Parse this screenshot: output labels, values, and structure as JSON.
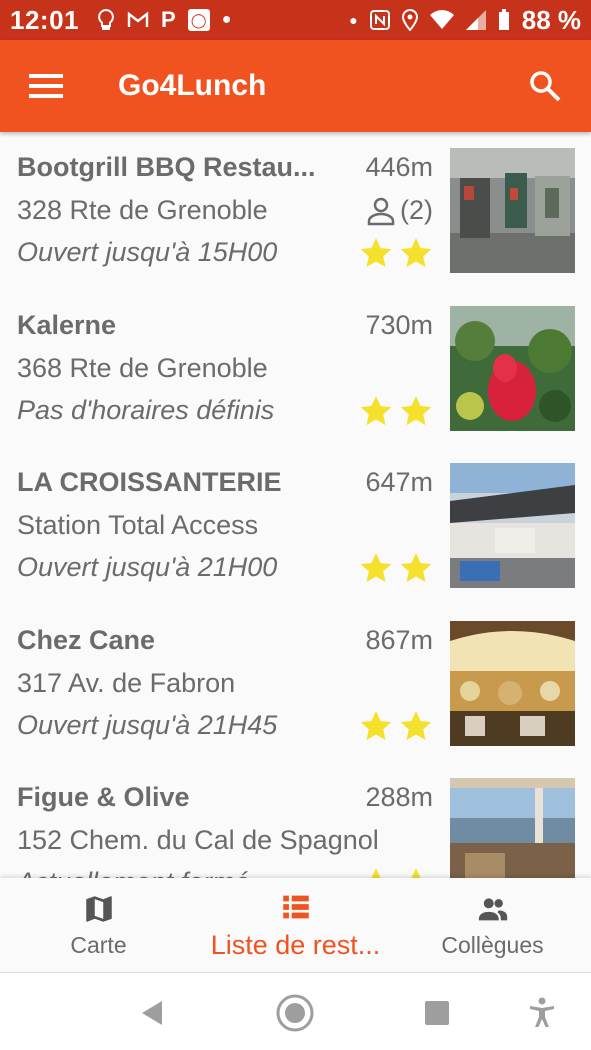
{
  "status_bar": {
    "time": "12:01",
    "battery": "88 %",
    "p_icon": "P"
  },
  "app_bar": {
    "title": "Go4Lunch",
    "menu_icon": "hamburger-menu-icon",
    "search_icon": "search-icon"
  },
  "restaurants": [
    {
      "name": "Bootgrill BBQ Restau...",
      "address": "328 Rte de Grenoble",
      "hours": "Ouvert jusqu'à 15H00",
      "distance": "446m",
      "workmates": "(2)",
      "stars": 2
    },
    {
      "name": "Kalerne",
      "address": "368 Rte de Grenoble",
      "hours": "Pas d'horaires définis",
      "distance": "730m",
      "stars": 2
    },
    {
      "name": "LA CROISSANTERIE",
      "address": "Station Total Access",
      "hours": "Ouvert jusqu'à 21H00",
      "distance": "647m",
      "stars": 2
    },
    {
      "name": "Chez Cane",
      "address": "317 Av. de Fabron",
      "hours": "Ouvert jusqu'à 21H45",
      "distance": "867m",
      "stars": 2
    },
    {
      "name": "Figue & Olive",
      "address": "152 Chem. du Cal de Spagnol",
      "hours": "Actuellement fermé",
      "distance": "288m",
      "stars": 2
    }
  ],
  "bottom_nav": {
    "items": [
      {
        "label": "Carte",
        "icon": "map-icon",
        "active": false
      },
      {
        "label": "Liste de rest...",
        "icon": "list-icon",
        "active": true
      },
      {
        "label": "Collègues",
        "icon": "people-icon",
        "active": false
      }
    ]
  },
  "colors": {
    "primary": "#f0531f",
    "status_bar": "#c6331a",
    "star": "#f5e12b",
    "text": "#6b6b6b"
  }
}
